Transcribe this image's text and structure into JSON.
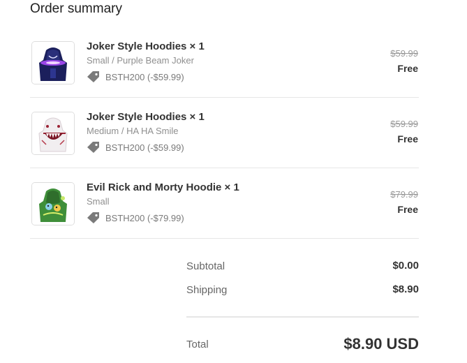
{
  "order_summary": {
    "title": "Order summary",
    "items": [
      {
        "name": "Joker Style Hoodies × 1",
        "variant": "Small / Purple Beam Joker",
        "discount": "BSTH200 (-$59.99)",
        "original_price": "$59.99",
        "final_price": "Free",
        "image": "joker-purple-hoodie-image"
      },
      {
        "name": "Joker Style Hoodies × 1",
        "variant": "Medium / HA HA Smile",
        "discount": "BSTH200 (-$59.99)",
        "original_price": "$59.99",
        "final_price": "Free",
        "image": "joker-smile-hoodie-image"
      },
      {
        "name": "Evil Rick and Morty Hoodie × 1",
        "variant": "Small",
        "discount": "BSTH200 (-$79.99)",
        "original_price": "$79.99",
        "final_price": "Free",
        "image": "rick-morty-hoodie-image"
      }
    ],
    "subtotal_label": "Subtotal",
    "subtotal_value": "$0.00",
    "shipping_label": "Shipping",
    "shipping_value": "$8.90",
    "total_label": "Total",
    "total_value": "$8.90 USD",
    "icons": {
      "discount": "tag-icon"
    },
    "colors": {
      "text": "#333333",
      "muted": "#8f8f8f",
      "divider": "#e6e6e6"
    }
  }
}
